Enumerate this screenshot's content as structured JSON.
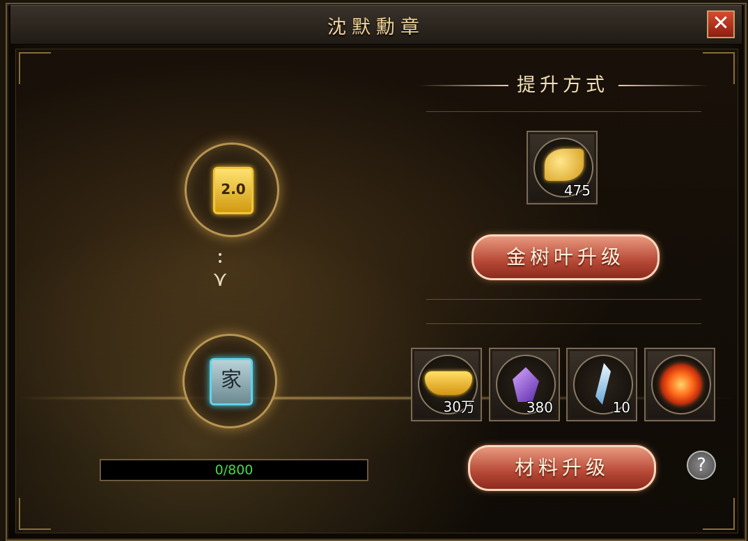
{
  "window": {
    "title": "沈默勳章",
    "close_label": "✕"
  },
  "medals": {
    "current_label": "2.0",
    "next_label": "家"
  },
  "progress": {
    "text": "0/800",
    "fraction": 0.0
  },
  "upgrade_section": {
    "title": "提升方式"
  },
  "gold_leaf": {
    "count": "475"
  },
  "buttons": {
    "gold_leaf_upgrade": "金树叶升级",
    "material_upgrade": "材料升级",
    "help": "?"
  },
  "materials": [
    {
      "icon": "gold-ingot-icon",
      "count": "30万"
    },
    {
      "icon": "purple-crystal-icon",
      "count": "380"
    },
    {
      "icon": "ice-shard-icon",
      "count": "10"
    },
    {
      "icon": "fire-orb-icon",
      "count": ""
    }
  ]
}
